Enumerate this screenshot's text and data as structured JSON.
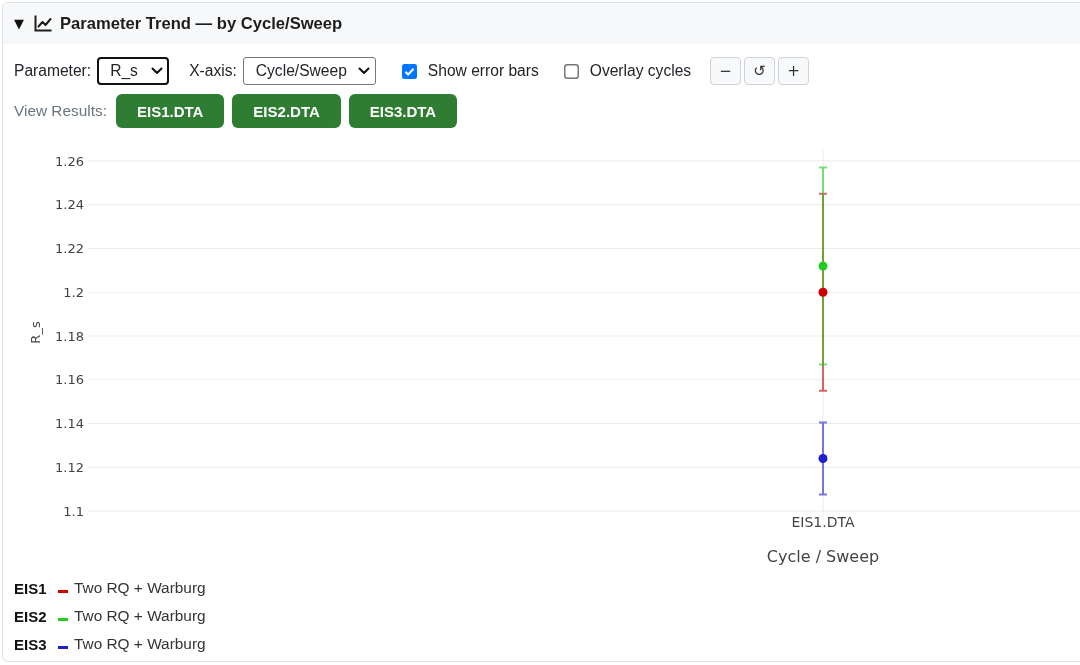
{
  "header": {
    "toggle": "▼",
    "title": "Parameter Trend — by Cycle/Sweep"
  },
  "controls": {
    "parameter": {
      "label": "Parameter:",
      "value": "R_s",
      "focused": true
    },
    "x_axis": {
      "label": "X-axis:",
      "value": "Cycle/Sweep",
      "focused": false
    },
    "checkboxes": [
      {
        "label": "Show error bars",
        "checked": true
      },
      {
        "label": "Overlay cycles",
        "checked": false
      }
    ],
    "zoom_buttons": [
      "−",
      "↺",
      "+"
    ]
  },
  "view_results": {
    "label": "View Results:",
    "files": [
      "EIS1.DTA",
      "EIS2.DTA",
      "EIS3.DTA"
    ]
  },
  "chart": {
    "chart_data": {
      "type": "scatter",
      "xlabel": "Cycle / Sweep",
      "ylabel": "R_s",
      "categories": [
        "EIS1.DTA"
      ],
      "series": [
        {
          "name": "EIS1",
          "color": "#cc0000",
          "values": [
            1.2
          ],
          "errors": [
            0.045
          ]
        },
        {
          "name": "EIS2",
          "color": "#22cc22",
          "values": [
            1.212
          ],
          "errors": [
            0.045
          ]
        },
        {
          "name": "EIS3",
          "color": "#1f1fcc",
          "values": [
            1.124
          ],
          "errors": [
            0.0165
          ]
        }
      ],
      "ylim": [
        1.1,
        1.26
      ],
      "yticks": [
        1.1,
        1.12,
        1.14,
        1.16,
        1.18,
        1.2,
        1.22,
        1.24,
        1.26
      ],
      "grid": true
    },
    "legend": [
      {
        "model": "Two RQ + Warburg"
      },
      {
        "model": "Two RQ + Warburg"
      },
      {
        "model": "Two RQ + Warburg"
      }
    ]
  }
}
